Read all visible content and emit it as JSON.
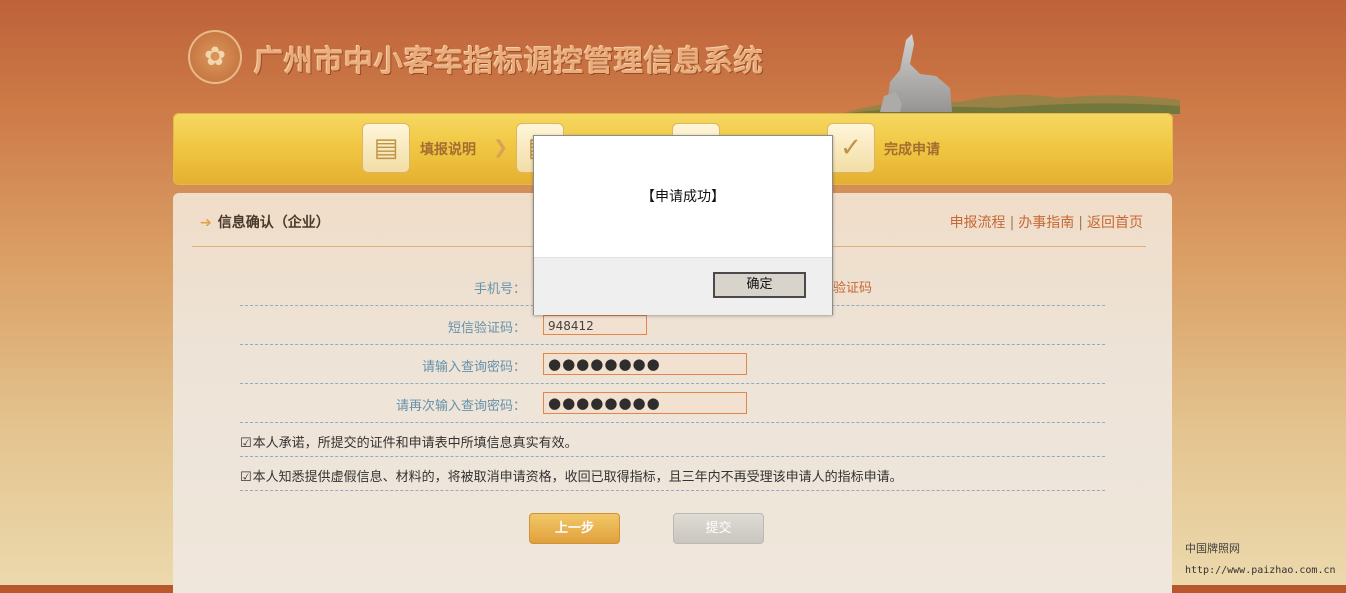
{
  "header": {
    "logo_icon": "emblem-icon",
    "title": "广州市中小客车指标调控管理信息系统"
  },
  "steps": [
    {
      "label": "填报说明",
      "icon": "document-icon"
    },
    {
      "label": "",
      "icon": "document-icon"
    },
    {
      "label": "",
      "icon": "profile-icon"
    },
    {
      "label": "完成申请",
      "icon": "checkmark-icon"
    }
  ],
  "panel": {
    "title": "信息确认（企业）",
    "links": [
      "申报流程",
      "办事指南",
      "返回首页"
    ],
    "link_separator": "|"
  },
  "form": {
    "phone_label": "手机号：",
    "sms_link": "验证码",
    "sms_code_label": "短信验证码：",
    "sms_code_value": "948412",
    "password_label": "请输入查询密码：",
    "password_value": "●●●●●●●●",
    "password_confirm_label": "请再次输入查询密码：",
    "password_confirm_value": "●●●●●●●●"
  },
  "agreements": [
    {
      "checked": true,
      "text": "本人承诺，所提交的证件和申请表中所填信息真实有效。"
    },
    {
      "checked": true,
      "text": "本人知悉提供虚假信息、材料的，将被取消申请资格，收回已取得指标，且三年内不再受理该申请人的指标申请。"
    }
  ],
  "buttons": {
    "prev": "上一步",
    "submit": "提交"
  },
  "dialog": {
    "message": "【申请成功】",
    "ok": "确定"
  },
  "watermark": {
    "line1": "中国牌照网",
    "line2": "http://www.paizhao.com.cn"
  },
  "colors": {
    "accent": "#c35d27",
    "banner_top": "#b8562c",
    "progress_yellow": "#efc233"
  }
}
